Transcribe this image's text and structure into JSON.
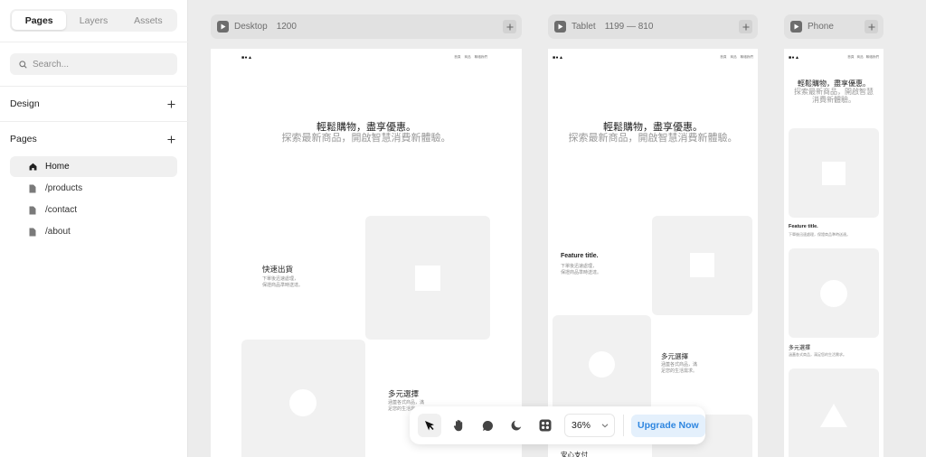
{
  "sidebar": {
    "tabs": [
      "Pages",
      "Layers",
      "Assets"
    ],
    "search_placeholder": "Search...",
    "design_label": "Design",
    "pages_label": "Pages",
    "pages": [
      "Home",
      "/products",
      "/contact",
      "/about"
    ]
  },
  "frames": {
    "desktop": {
      "name": "Desktop",
      "size": "1200"
    },
    "tablet": {
      "name": "Tablet",
      "size": "1199 — 810"
    },
    "phone": {
      "name": "Phone",
      "size": ""
    }
  },
  "site": {
    "logo": "■●▲",
    "nav": [
      "首頁",
      "商品",
      "聯絡我們"
    ],
    "hero_title": "輕鬆購物，盡享優惠。",
    "hero_sub": "探索最新商品，開啟智慧消費新體驗。",
    "desktop": {
      "feature1_title": "快速出貨",
      "feature1_desc": [
        "下單後迅速處理，",
        "保證商品準時送達。"
      ],
      "feature2_title": "多元選擇",
      "feature2_desc": [
        "涵蓋各式商品，滿",
        "足您的生活需..."
      ]
    },
    "tablet": {
      "feature1_title": "Feature title.",
      "feature1_desc": [
        "下單後迅速處理，",
        "保證商品準時送達。"
      ],
      "feature2_title": "多元選擇",
      "feature2_desc": [
        "涵蓋各式商品，滿",
        "足您的生活需求。"
      ],
      "feature3_title": "安心支付"
    },
    "phone": {
      "hero_sub_lines": [
        "探索最新商品，開啟智慧",
        "消費新體驗。"
      ],
      "feature1_title": "Feature title.",
      "feature1_desc": "下單後迅速處理，保證商品準時送達。",
      "feature2_title": "多元選擇",
      "feature2_desc": "涵蓋各式商品，滿足您的生活需求。"
    }
  },
  "toolbar": {
    "zoom": "36%",
    "upgrade_label": "Upgrade Now",
    "tools": [
      "pointer-icon",
      "hand-icon",
      "comment-icon",
      "dark-mode-icon",
      "apps-icon"
    ]
  },
  "colors": {
    "accent": "#2e86e0",
    "canvas": "#ececec"
  }
}
